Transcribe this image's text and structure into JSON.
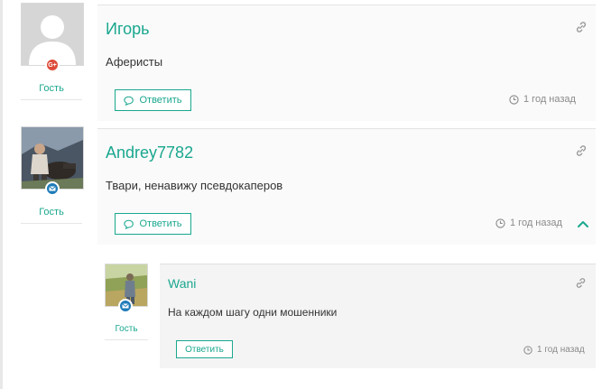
{
  "comments": [
    {
      "author": "Игорь",
      "text": "Аферисты",
      "reply_label": "Ответить",
      "time": "1 год назад",
      "role": "Гость",
      "badge": "G+",
      "badge_color": "#dd4b39"
    },
    {
      "author": "Andrey7782",
      "text": "Твари, ненавижу псевдокаперов",
      "reply_label": "Ответить",
      "time": "1 год назад",
      "role": "Гость",
      "badge_color": "#1e7bb8"
    }
  ],
  "replies": [
    {
      "author": "Wani",
      "text": "На каждом шагу одни мошенники",
      "reply_label": "Ответить",
      "time": "1 год назад",
      "role": "Гость",
      "badge_color": "#1e7bb8"
    }
  ],
  "colors": {
    "accent": "#1aa78f",
    "meta": "#8a8a8a"
  }
}
